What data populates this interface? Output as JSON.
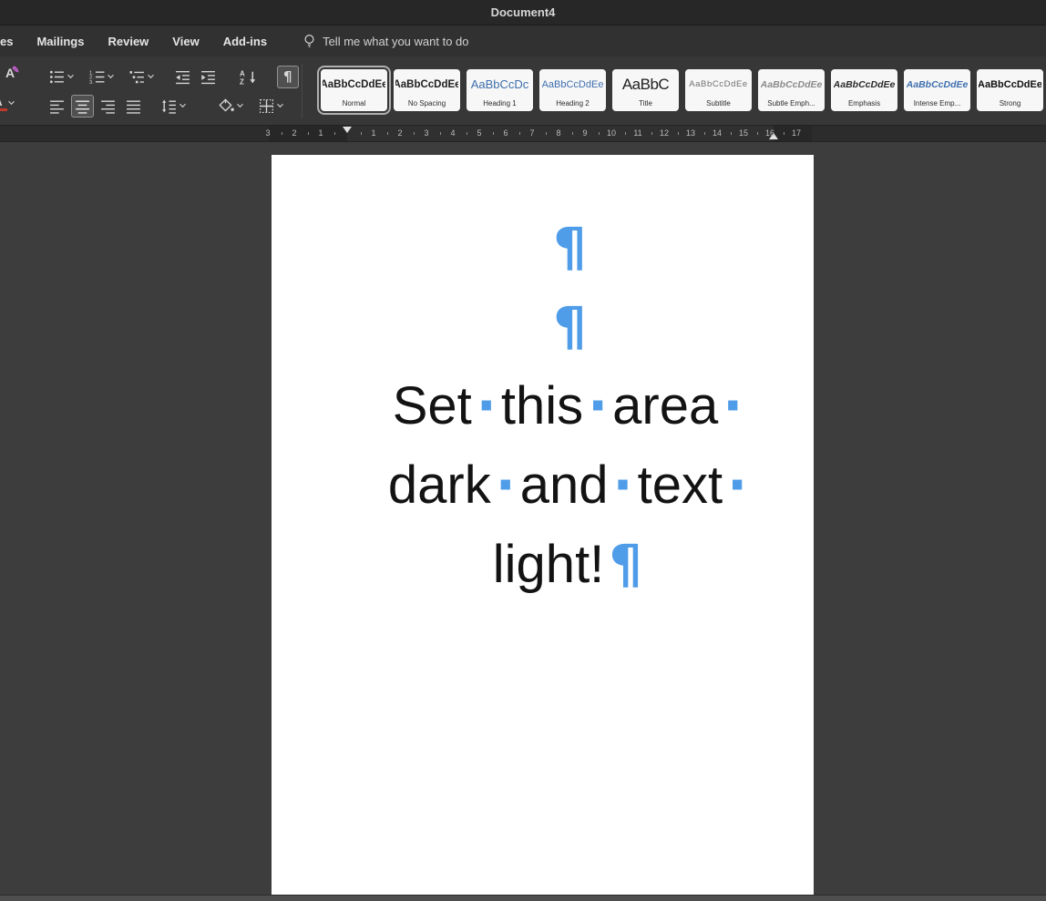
{
  "titlebar": {
    "title": "Document4"
  },
  "tabs": {
    "partial": "es",
    "items": [
      "Mailings",
      "Review",
      "View",
      "Add-ins"
    ],
    "tellme": "Tell me what you want to do"
  },
  "toolbar": {
    "pilcrow": "¶",
    "sort_a": "A",
    "sort_z": "Z",
    "text_effects_letter": "A",
    "font_color_letter": "A"
  },
  "styles": {
    "items": [
      {
        "preview": "AaBbCcDdEe",
        "name": "Normal",
        "kind": "normal",
        "selected": true
      },
      {
        "preview": "AaBbCcDdEe",
        "name": "No Spacing",
        "kind": "normal",
        "selected": false
      },
      {
        "preview": "AaBbCcDc",
        "name": "Heading 1",
        "kind": "h1",
        "selected": false
      },
      {
        "preview": "AaBbCcDdEe",
        "name": "Heading 2",
        "kind": "h2",
        "selected": false
      },
      {
        "preview": "AaBbC",
        "name": "Title",
        "kind": "title",
        "selected": false
      },
      {
        "preview": "AaBbCcDdEe",
        "name": "Subtitle",
        "kind": "subtitle",
        "selected": false
      },
      {
        "preview": "AaBbCcDdEe",
        "name": "Subtle Emph...",
        "kind": "subtle",
        "selected": false
      },
      {
        "preview": "AaBbCcDdEe",
        "name": "Emphasis",
        "kind": "emphasis",
        "selected": false
      },
      {
        "preview": "AaBbCcDdEe",
        "name": "Intense Emp...",
        "kind": "intense",
        "selected": false
      },
      {
        "preview": "AaBbCcDdEe",
        "name": "Strong",
        "kind": "strong",
        "selected": false
      }
    ]
  },
  "ruler": {
    "left_numbers": [
      "3",
      "2",
      "1"
    ],
    "main_numbers": [
      "1",
      "2",
      "3",
      "4",
      "5",
      "6",
      "7",
      "8",
      "9",
      "10",
      "11",
      "12",
      "13",
      "14",
      "15",
      "16",
      "17"
    ]
  },
  "document": {
    "paragraphs": [
      {
        "tokens": [
          {
            "t": "¶",
            "k": "m"
          }
        ]
      },
      {
        "tokens": [
          {
            "t": "¶",
            "k": "m"
          }
        ]
      },
      {
        "tokens": [
          {
            "t": "Set",
            "k": "w"
          },
          {
            "t": "·",
            "k": "m"
          },
          {
            "t": "this",
            "k": "w"
          },
          {
            "t": "·",
            "k": "m"
          },
          {
            "t": "area",
            "k": "w"
          },
          {
            "t": "·",
            "k": "m"
          }
        ]
      },
      {
        "tokens": [
          {
            "t": "dark",
            "k": "w"
          },
          {
            "t": "·",
            "k": "m"
          },
          {
            "t": "and",
            "k": "w"
          },
          {
            "t": "·",
            "k": "m"
          },
          {
            "t": "text",
            "k": "w"
          },
          {
            "t": "·",
            "k": "m"
          }
        ]
      },
      {
        "tokens": [
          {
            "t": "light!",
            "k": "w"
          },
          {
            "t": "¶",
            "k": "m"
          }
        ]
      }
    ]
  },
  "colors": {
    "accent_blue": "#4f9ce8",
    "heading_blue": "#3f6fae",
    "page_white": "#ffffff",
    "chrome_dark": "#373737"
  }
}
